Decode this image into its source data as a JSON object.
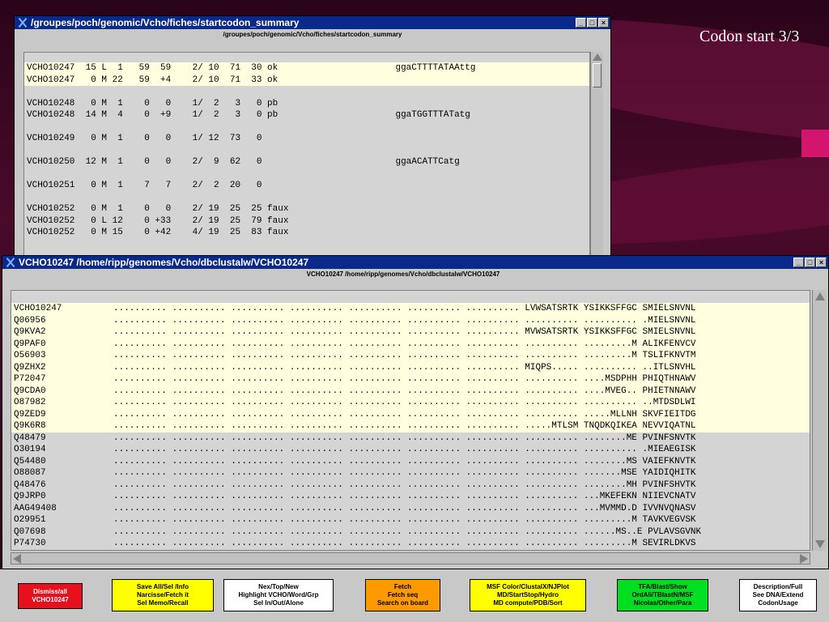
{
  "slide": {
    "title": "Codon start 3/3"
  },
  "window1": {
    "title": "/groupes/poch/genomic/Vcho/fiches/startcodon_summary",
    "subtitle": "/groupes/poch/genomic/Vcho/fiches/startcodon_summary",
    "lines": [
      "VCHO10247  15 L  1   59  59    2/ 10  71  30 ok                      ggaCTTTTATAAttg",
      "VCHO10247   0 M 22   59  +4    2/ 10  71  33 ok",
      "",
      "VCHO10248   0 M  1    0   0    1/  2   3   0 pb",
      "VCHO10248  14 M  4    0  +9    1/  2   3   0 pb                      ggaTGGTTTATatg",
      "",
      "VCHO10249   0 M  1    0   0    1/ 12  73   0",
      "",
      "VCHO10250  12 M  1    0   0    2/  9  62   0                         ggaACATTCatg",
      "",
      "VCHO10251   0 M  1    7   7    2/  2  20   0",
      "",
      "VCHO10252   0 M  1    0   0    2/ 19  25  25 faux",
      "VCHO10252   0 L 12    0 +33    2/ 19  25  79 faux",
      "VCHO10252   0 M 15    0 +42    4/ 19  25  83 faux"
    ]
  },
  "window2": {
    "title": "VCHO10247   /home/ripp/genomes/Vcho/dbclustalw/VCHO10247",
    "subtitle": "VCHO10247   /home/ripp/genomes/Vcho/dbclustalw/VCHO10247",
    "highlighted_rows": 11,
    "rows": [
      {
        "id": "VCHO10247",
        "seq": ".......... .......... .......... .......... .......... .......... .......... LVWSATSRTK YSIKKSFFGC SMIELSNVNL"
      },
      {
        "id": "Q06956",
        "seq": ".......... .......... .......... .......... .......... .......... .......... .......... .......... .MIELSNVNL"
      },
      {
        "id": "Q9KVA2",
        "seq": ".......... .......... .......... .......... .......... .......... .......... MVWSATSRTK YSIKKSFFGC SMIELSNVNL"
      },
      {
        "id": "Q9PAF0",
        "seq": ".......... .......... .......... .......... .......... .......... .......... .......... .........M ALIKFENVCV"
      },
      {
        "id": "O56903",
        "seq": ".......... .......... .......... .......... .......... .......... .......... .......... .........M TSLIFKNVTM"
      },
      {
        "id": "Q9ZHX2",
        "seq": ".......... .......... .......... .......... .......... .......... .......... MIQPS..... .......... ..ITLSNVHL"
      },
      {
        "id": "P72047",
        "seq": ".......... .......... .......... .......... .......... .......... .......... .......... ....MSDPHH PHIQTHNAWV"
      },
      {
        "id": "Q9CDA0",
        "seq": ".......... .......... .......... .......... .......... .......... .......... .......... ....MVEG.. PHIETNNAWV"
      },
      {
        "id": "O87982",
        "seq": ".......... .......... .......... .......... .......... .......... .......... .......... .......... ..MTDSDLWI"
      },
      {
        "id": "Q9ZED9",
        "seq": ".......... .......... .......... .......... .......... .......... .......... .......... .....MLLNH SKVFIEITDG"
      },
      {
        "id": "Q9K6R8",
        "seq": ".......... .......... .......... .......... .......... .......... .......... .....MTLSM TNQDKQIKEA NEVVIQATNL"
      },
      {
        "id": "Q48479",
        "seq": ".......... .......... .......... .......... .......... .......... .......... .......... ........ME PVINFSNVTK"
      },
      {
        "id": "O30194",
        "seq": ".......... .......... .......... .......... .......... .......... .......... .......... .......... .MIEAEGISK"
      },
      {
        "id": "Q54480",
        "seq": ".......... .......... .......... .......... .......... .......... .......... .......... ........MS VAIEFKNVTK"
      },
      {
        "id": "O88087",
        "seq": ".......... .......... .......... .......... .......... .......... .......... .......... .......MSE YAIDIQHITK"
      },
      {
        "id": "Q48476",
        "seq": ".......... .......... .......... .......... .......... .......... .......... .......... ........MH PVINFSHVTK"
      },
      {
        "id": "Q9JRP0",
        "seq": ".......... .......... .......... .......... .......... .......... .......... .......... ...MKEFEKN NIIEVCNATV"
      },
      {
        "id": "AAG49408",
        "seq": ".......... .......... .......... .......... .......... .......... .......... .......... ...MVMMD.D IVVNVQNASV"
      },
      {
        "id": "O29951",
        "seq": ".......... .......... .......... .......... .......... .......... .......... .......... .........M TAVKVEGVSK"
      },
      {
        "id": "Q07698",
        "seq": ".......... .......... .......... .......... .......... .......... .......... .......... ......MS..E PVLAVSGVNK"
      },
      {
        "id": "P74730",
        "seq": ".......... .......... .......... .......... .......... .......... .......... .......... .........M SEVIRLDKVS"
      }
    ]
  },
  "buttons": [
    {
      "name": "dismiss-all-button",
      "bg": "#e8101c",
      "lines": [
        "Dismiss/all",
        "VCHO10247"
      ]
    },
    {
      "name": "save-all-button",
      "bg": "#ffff00",
      "lines": [
        "Save All/Sel /Info",
        "Narcisse/Fetch it",
        "Sel Memo/Recall"
      ]
    },
    {
      "name": "next-top-new-button",
      "bg": "#ffffff",
      "lines": [
        "Nex/Top/New",
        "Highlight VCHO/Word/Grp",
        "Sel In/Out/Alone"
      ]
    },
    {
      "name": "fetch-button",
      "bg": "#ff9900",
      "lines": [
        "Fetch",
        "Fetch seq",
        "Search on board"
      ]
    },
    {
      "name": "msf-color-button",
      "bg": "#ffff00",
      "lines": [
        "MSF Color/ClustalX/NJPlot",
        "MD/StartStop/Hydro",
        "MD compute/PDB/Sort"
      ]
    },
    {
      "name": "tfa-blast-button",
      "bg": "#00e020",
      "lines": [
        "TFA/Blast/Show",
        "OrdAli/TBlastN/MSF",
        "Nicolas/Other/Para"
      ]
    },
    {
      "name": "description-button",
      "bg": "#ffffff",
      "lines": [
        "Description/Full",
        "See DNA/Extend",
        "CodonUsage"
      ]
    }
  ]
}
